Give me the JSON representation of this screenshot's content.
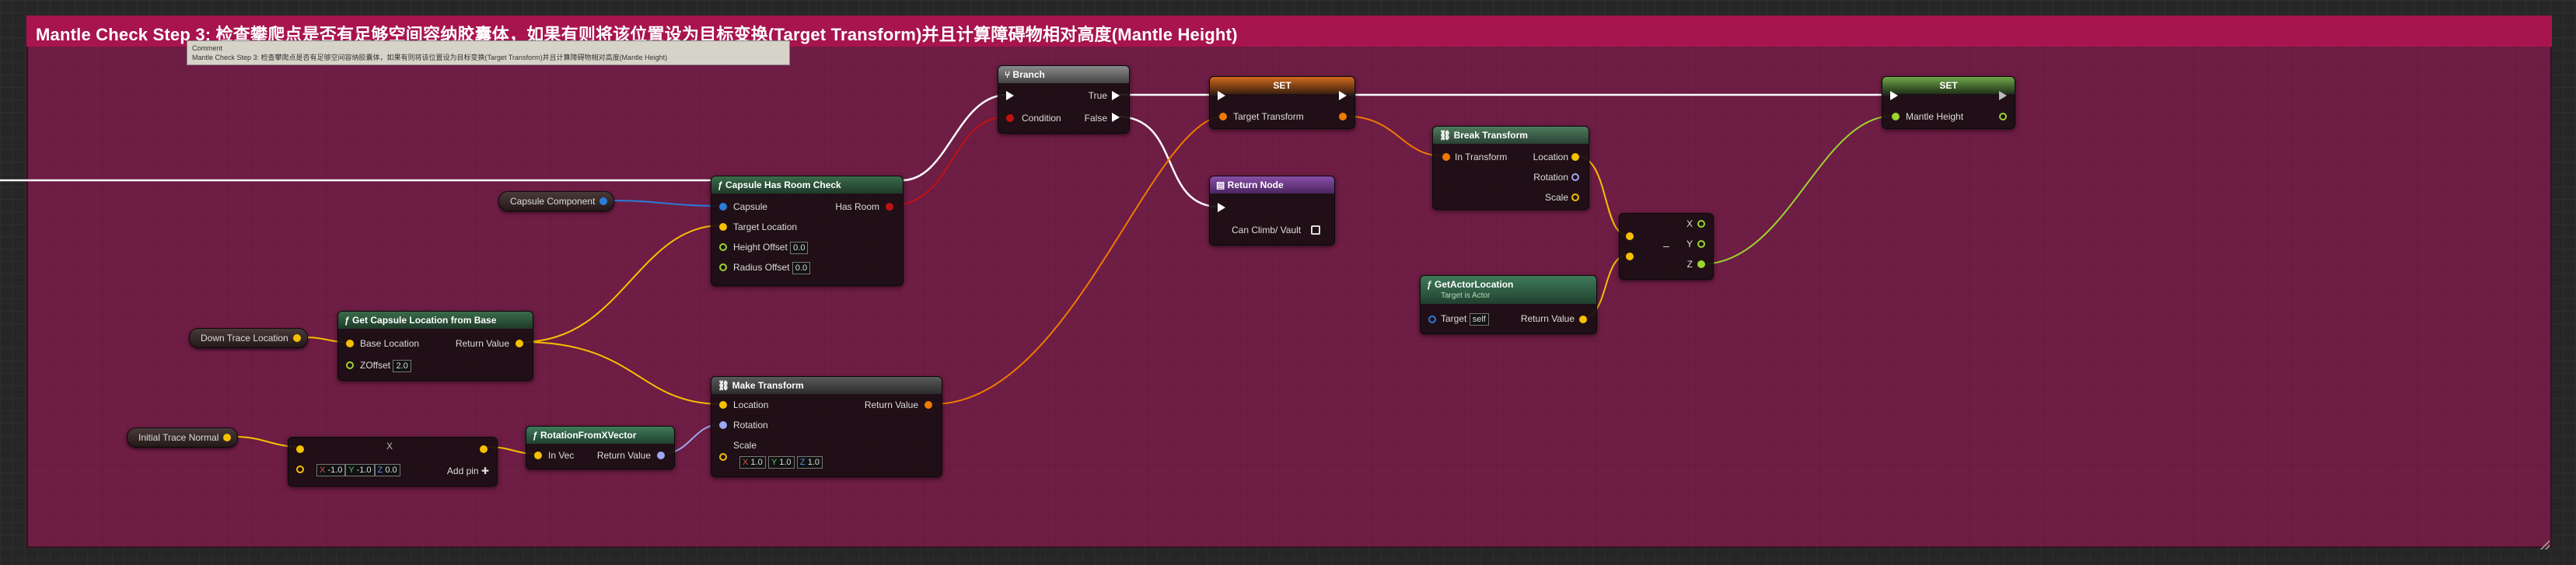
{
  "comment": {
    "title": "Mantle Check Step 3: 检查攀爬点是否有足够空间容纳胶囊体，如果有则将该位置设为目标变换(Target Transform)并且计算障碍物相对高度(Mantle Height)",
    "tooltip_label": "Comment",
    "tooltip_text": "Mantle Check Step 3: 检查攀爬点是否有足够空间容纳胶囊体，如果有则将该位置设为目标变换(Target Transform)并且计算障碍物相对高度(Mantle Height)"
  },
  "colors": {
    "comment_bg": "#6e1d44",
    "comment_header": "#a8144e",
    "float_pin": "#9bd431",
    "vector_pin": "#f5c000",
    "object_pin": "#2a7dd9",
    "bool_pin": "#c01212",
    "transform_pin": "#f07a00",
    "rotator_pin": "#9da8f2"
  },
  "nodes": {
    "branch": {
      "title": "Branch",
      "condition": "Condition",
      "true": "True",
      "false": "False"
    },
    "set_transform": {
      "title": "SET",
      "pin": "Target Transform"
    },
    "set_height": {
      "title": "SET",
      "pin": "Mantle Height"
    },
    "return_node": {
      "title": "Return Node",
      "pin": "Can Climb/ Vault"
    },
    "break_transform": {
      "title": "Break Transform",
      "in": "In Transform",
      "location": "Location",
      "rotation": "Rotation",
      "scale": "Scale"
    },
    "break_vector": {
      "x": "X",
      "y": "Y",
      "z": "Z",
      "minus": "–"
    },
    "get_actor_location": {
      "title": "GetActorLocation",
      "subtitle": "Target is Actor",
      "target": "Target",
      "target_value": "self",
      "return": "Return Value"
    },
    "capsule_check": {
      "title": "Capsule Has Room Check",
      "capsule": "Capsule",
      "has_room": "Has Room",
      "target_location": "Target Location",
      "height_offset": "Height Offset",
      "height_offset_value": "0.0",
      "radius_offset": "Radius Offset",
      "radius_offset_value": "0.0"
    },
    "capsule_component": {
      "label": "Capsule Component"
    },
    "get_capsule_location": {
      "title": "Get Capsule Location from Base",
      "base_location": "Base Location",
      "return": "Return Value",
      "zoffset": "ZOffset",
      "zoffset_value": "2.0"
    },
    "down_trace": {
      "label": "Down Trace Location"
    },
    "make_transform": {
      "title": "Make Transform",
      "location": "Location",
      "rotation": "Rotation",
      "scale": "Scale",
      "return": "Return Value",
      "sx": "1.0",
      "sy": "1.0",
      "sz": "1.0",
      "x_label": "X",
      "y_label": "Y",
      "z_label": "Z"
    },
    "initial_trace": {
      "label": "Initial Trace Normal"
    },
    "multiply": {
      "symbol": "X",
      "x": "-1.0",
      "y": "-1.0",
      "z": "0.0",
      "x_label": "X",
      "y_label": "Y",
      "z_label": "Z",
      "add_pin": "Add pin",
      "plus": "✚"
    },
    "rotation_from_x": {
      "title": "RotationFromXVector",
      "in": "In Vec",
      "return": "Return Value"
    }
  }
}
